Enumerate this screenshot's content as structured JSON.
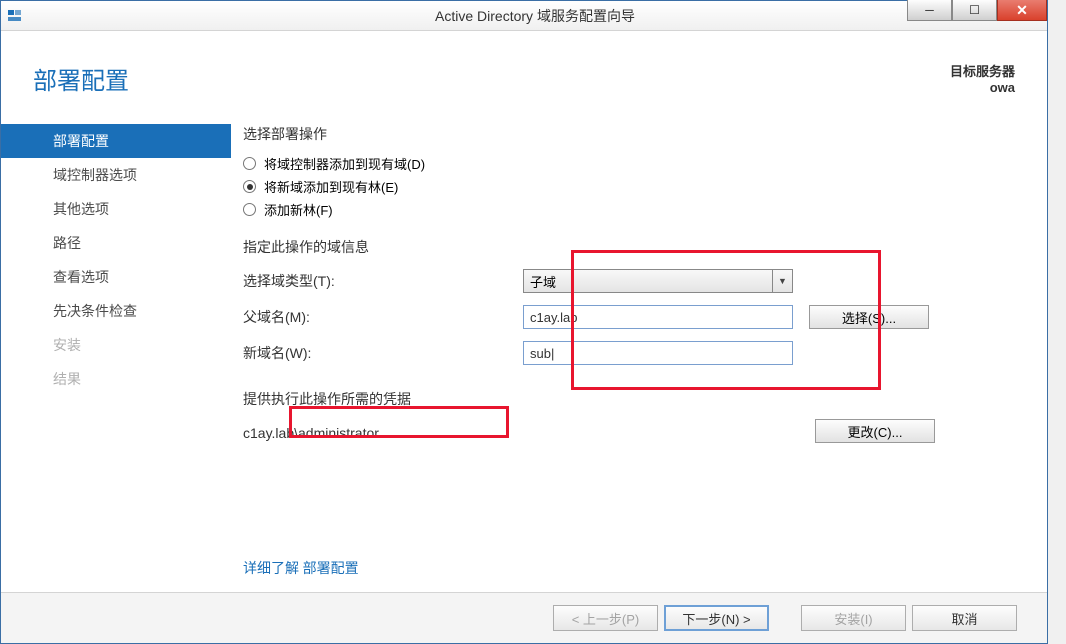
{
  "window": {
    "title": "Active Directory 域服务配置向导"
  },
  "header": {
    "page_title": "部署配置",
    "target_label": "目标服务器",
    "target_value": "owa"
  },
  "sidebar": {
    "items": [
      {
        "label": "部署配置",
        "selected": true,
        "disabled": false
      },
      {
        "label": "域控制器选项",
        "selected": false,
        "disabled": false
      },
      {
        "label": "其他选项",
        "selected": false,
        "disabled": false
      },
      {
        "label": "路径",
        "selected": false,
        "disabled": false
      },
      {
        "label": "查看选项",
        "selected": false,
        "disabled": false
      },
      {
        "label": "先决条件检查",
        "selected": false,
        "disabled": false
      },
      {
        "label": "安装",
        "selected": false,
        "disabled": true
      },
      {
        "label": "结果",
        "selected": false,
        "disabled": true
      }
    ]
  },
  "content": {
    "deploy_op_label": "选择部署操作",
    "radios": [
      {
        "label": "将域控制器添加到现有域(D)",
        "checked": false
      },
      {
        "label": "将新域添加到现有林(E)",
        "checked": true
      },
      {
        "label": "添加新林(F)",
        "checked": false
      }
    ],
    "domain_info_label": "指定此操作的域信息",
    "domain_type_label": "选择域类型(T):",
    "domain_type_value": "子域",
    "parent_domain_label": "父域名(M):",
    "parent_domain_value": "c1ay.lab",
    "new_domain_label": "新域名(W):",
    "new_domain_value": "sub",
    "select_btn": "选择(S)...",
    "creds_section_label": "提供执行此操作所需的凭据",
    "creds_value": "c1ay.lab\\administrator",
    "change_btn": "更改(C)...",
    "more_info_prefix": "详细了解",
    "more_info_link": "部署配置"
  },
  "footer": {
    "prev": "< 上一步(P)",
    "next": "下一步(N) >",
    "install": "安装(I)",
    "cancel": "取消"
  }
}
